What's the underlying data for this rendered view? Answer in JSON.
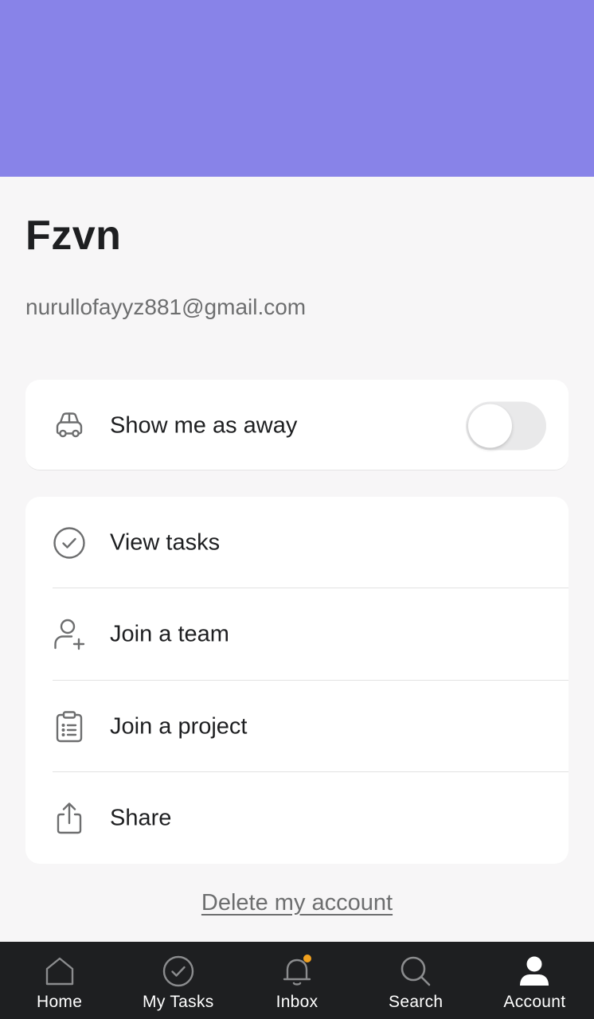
{
  "profile": {
    "name": "Fzvn",
    "email": "nurullofayyz881@gmail.com",
    "banner_color": "#8883e8"
  },
  "away": {
    "icon": "car-icon",
    "label": "Show me as away",
    "enabled": false
  },
  "menu": {
    "items": [
      {
        "icon": "check-circle-icon",
        "label": "View tasks"
      },
      {
        "icon": "add-person-icon",
        "label": "Join a team"
      },
      {
        "icon": "clipboard-icon",
        "label": "Join a project"
      },
      {
        "icon": "share-icon",
        "label": "Share"
      }
    ]
  },
  "delete_label": "Delete my account",
  "tabbar": {
    "tabs": [
      {
        "icon": "home-icon",
        "label": "Home",
        "active": false
      },
      {
        "icon": "check-circle-icon",
        "label": "My Tasks",
        "active": false
      },
      {
        "icon": "bell-icon",
        "label": "Inbox",
        "active": false,
        "notification_dot_color": "#f1a11f"
      },
      {
        "icon": "search-icon",
        "label": "Search",
        "active": false
      },
      {
        "icon": "person-icon",
        "label": "Account",
        "active": true
      }
    ]
  }
}
